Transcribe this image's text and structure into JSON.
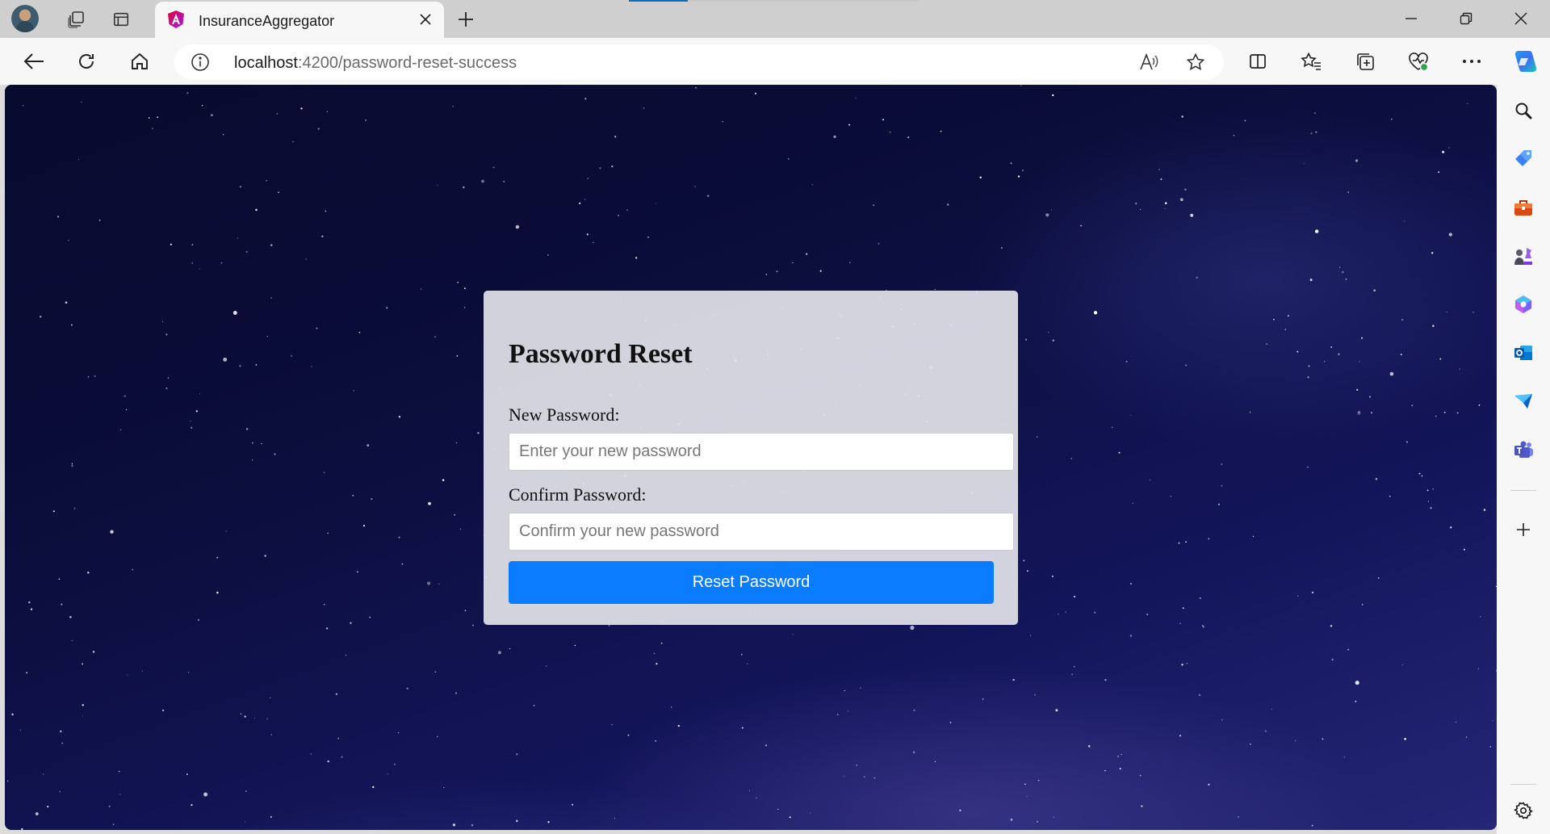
{
  "browser": {
    "tab": {
      "title": "InsuranceAggregator"
    },
    "address": {
      "host": "localhost",
      "path": ":4200/password-reset-success"
    }
  },
  "form": {
    "title": "Password Reset",
    "new_password": {
      "label": "New Password:",
      "placeholder": "Enter your new password",
      "value": ""
    },
    "confirm_password": {
      "label": "Confirm Password:",
      "placeholder": "Confirm your new password",
      "value": ""
    },
    "submit_label": "Reset Password"
  },
  "colors": {
    "accent": "#0a7cff",
    "edge_blue": "#0f6cbd"
  },
  "icons": {
    "toolbar": [
      "back-icon",
      "refresh-icon",
      "home-icon",
      "info-icon",
      "read-aloud-icon",
      "favorite-star-icon",
      "split-screen-icon",
      "favorites-icon",
      "collections-icon",
      "browser-essentials-icon",
      "more-icon",
      "copilot-icon"
    ],
    "sidebar": [
      "search-icon",
      "shopping-icon",
      "tools-icon",
      "games-icon",
      "microsoft-365-icon",
      "outlook-icon",
      "drop-icon",
      "teams-icon",
      "add-icon",
      "settings-icon"
    ]
  }
}
